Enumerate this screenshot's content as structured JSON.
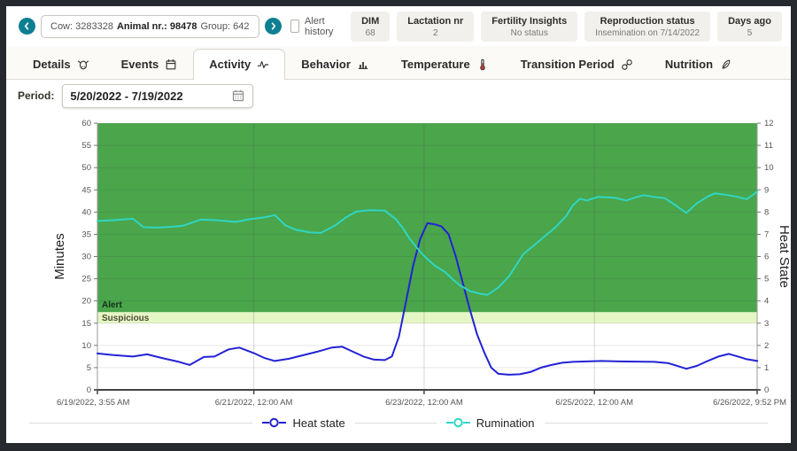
{
  "header": {
    "cow_selector": {
      "cow": "Cow: 3283328",
      "animal": "Animal nr.: 98478",
      "group": "Group: 642"
    },
    "alert_history_label": "Alert history",
    "info_boxes": [
      {
        "label": "DIM",
        "value": "68"
      },
      {
        "label": "Lactation nr",
        "value": "2"
      },
      {
        "label": "Fertility Insights",
        "value": "No status"
      },
      {
        "label": "Reproduction status",
        "value": "Insemination on 7/14/2022"
      },
      {
        "label": "Days ago",
        "value": "5"
      }
    ]
  },
  "tabs": [
    {
      "label": "Details",
      "icon": "cow-icon",
      "active": false
    },
    {
      "label": "Events",
      "icon": "calendar-icon",
      "active": false
    },
    {
      "label": "Activity",
      "icon": "activity-icon",
      "active": true
    },
    {
      "label": "Behavior",
      "icon": "bar-chart-icon",
      "active": false
    },
    {
      "label": "Temperature",
      "icon": "thermometer-icon",
      "active": false
    },
    {
      "label": "Transition Period",
      "icon": "link-icon",
      "active": false
    },
    {
      "label": "Nutrition",
      "icon": "feather-icon",
      "active": false
    }
  ],
  "period": {
    "label": "Period:",
    "value": "5/20/2022 - 7/19/2022"
  },
  "chart_data": {
    "type": "line",
    "left_axis": {
      "label": "Minutes",
      "min": 0,
      "max": 60,
      "step": 5
    },
    "right_axis": {
      "label": "Heat State",
      "min": 0,
      "max": 12,
      "step": 1
    },
    "x_axis": {
      "total_hours": 185.95,
      "ticks": [
        {
          "hours": 0,
          "label": "6/19/2022, 3:55 AM",
          "align": "start",
          "grid": false
        },
        {
          "hours": 44.08,
          "label": "6/21/2022, 12:00 AM",
          "align": "middle",
          "grid": true
        },
        {
          "hours": 92.08,
          "label": "6/23/2022, 12:00 AM",
          "align": "middle",
          "grid": true
        },
        {
          "hours": 140.08,
          "label": "6/25/2022, 12:00 AM",
          "align": "middle",
          "grid": true
        },
        {
          "hours": 185.95,
          "label": "6/26/2022, 9:52 PM",
          "align": "end",
          "grid": false
        }
      ]
    },
    "zones": [
      {
        "name": "Suspicious",
        "from_min": 15,
        "to_min": 17.5,
        "color": "#e4f6c4",
        "label_color": "#4c4c33"
      },
      {
        "name": "Alert",
        "from_min": 17.5,
        "to_min": 60,
        "color": "#4aa54b",
        "label_color": "#15301a"
      }
    ],
    "series": [
      {
        "name": "Heat state",
        "axis": "right",
        "color": "#2222d6",
        "points": [
          [
            0,
            1.64
          ],
          [
            5,
            1.56
          ],
          [
            10,
            1.5
          ],
          [
            14,
            1.6
          ],
          [
            18,
            1.44
          ],
          [
            23,
            1.26
          ],
          [
            26,
            1.12
          ],
          [
            30,
            1.48
          ],
          [
            33,
            1.5
          ],
          [
            37,
            1.82
          ],
          [
            40,
            1.9
          ],
          [
            44,
            1.66
          ],
          [
            47,
            1.44
          ],
          [
            50,
            1.3
          ],
          [
            54,
            1.4
          ],
          [
            58,
            1.56
          ],
          [
            62,
            1.72
          ],
          [
            66,
            1.9
          ],
          [
            69,
            1.94
          ],
          [
            72,
            1.72
          ],
          [
            75,
            1.5
          ],
          [
            78,
            1.36
          ],
          [
            81,
            1.34
          ],
          [
            83,
            1.5
          ],
          [
            85,
            2.4
          ],
          [
            87,
            4
          ],
          [
            89,
            5.6
          ],
          [
            91,
            6.8
          ],
          [
            93,
            7.5
          ],
          [
            95,
            7.45
          ],
          [
            97,
            7.35
          ],
          [
            99,
            7
          ],
          [
            101,
            6
          ],
          [
            103,
            4.8
          ],
          [
            105,
            3.6
          ],
          [
            107,
            2.5
          ],
          [
            109,
            1.7
          ],
          [
            111,
            1
          ],
          [
            113,
            0.72
          ],
          [
            116,
            0.68
          ],
          [
            119,
            0.7
          ],
          [
            122,
            0.8
          ],
          [
            125,
            1
          ],
          [
            128,
            1.12
          ],
          [
            131,
            1.22
          ],
          [
            134,
            1.26
          ],
          [
            138,
            1.28
          ],
          [
            142,
            1.3
          ],
          [
            147,
            1.28
          ],
          [
            152,
            1.27
          ],
          [
            157,
            1.26
          ],
          [
            161,
            1.2
          ],
          [
            164,
            1.05
          ],
          [
            166,
            0.95
          ],
          [
            169,
            1.08
          ],
          [
            172,
            1.3
          ],
          [
            175,
            1.5
          ],
          [
            178,
            1.62
          ],
          [
            181,
            1.48
          ],
          [
            183,
            1.38
          ],
          [
            186,
            1.3
          ]
        ]
      },
      {
        "name": "Rumination",
        "axis": "left",
        "color": "#2fd6c3",
        "points": [
          [
            0,
            38
          ],
          [
            5,
            38.2
          ],
          [
            10,
            38.5
          ],
          [
            13,
            36.6
          ],
          [
            17,
            36.5
          ],
          [
            21,
            36.7
          ],
          [
            24,
            36.9
          ],
          [
            29,
            38.3
          ],
          [
            33,
            38.2
          ],
          [
            36,
            38
          ],
          [
            39,
            37.8
          ],
          [
            43,
            38.4
          ],
          [
            47,
            38.8
          ],
          [
            50,
            39.3
          ],
          [
            53,
            37
          ],
          [
            56,
            36
          ],
          [
            60,
            35.4
          ],
          [
            63,
            35.3
          ],
          [
            67,
            37
          ],
          [
            70,
            38.8
          ],
          [
            73,
            40.1
          ],
          [
            77,
            40.4
          ],
          [
            81,
            40.3
          ],
          [
            84,
            38.5
          ],
          [
            86,
            36.5
          ],
          [
            88,
            34
          ],
          [
            90,
            32
          ],
          [
            92,
            30.2
          ],
          [
            95,
            28
          ],
          [
            98,
            26.5
          ],
          [
            100,
            25
          ],
          [
            102,
            23.6
          ],
          [
            105,
            22.2
          ],
          [
            108,
            21.6
          ],
          [
            110,
            21.4
          ],
          [
            113,
            23
          ],
          [
            116,
            25.5
          ],
          [
            118,
            28
          ],
          [
            120,
            30.5
          ],
          [
            123,
            32.5
          ],
          [
            126,
            34.5
          ],
          [
            129,
            36.5
          ],
          [
            132,
            39
          ],
          [
            134,
            41.5
          ],
          [
            136,
            43
          ],
          [
            138,
            42.6
          ],
          [
            141,
            43.4
          ],
          [
            144,
            43.3
          ],
          [
            146,
            43.2
          ],
          [
            149,
            42.6
          ],
          [
            152,
            43.4
          ],
          [
            154,
            43.8
          ],
          [
            157,
            43.4
          ],
          [
            160,
            43.1
          ],
          [
            163,
            41.5
          ],
          [
            166,
            39.8
          ],
          [
            169,
            42
          ],
          [
            172,
            43.5
          ],
          [
            174,
            44.2
          ],
          [
            177,
            43.9
          ],
          [
            180,
            43.5
          ],
          [
            183,
            42.9
          ],
          [
            186,
            44.6
          ]
        ]
      }
    ]
  },
  "legend": [
    {
      "label": "Heat state",
      "color": "#2222d6"
    },
    {
      "label": "Rumination",
      "color": "#2fd6c3"
    }
  ],
  "colors": {
    "accent_teal": "#0d7f93",
    "alert_zone": "#4aa54b",
    "suspicious_zone": "#e4f6c4",
    "frame": "#26292e"
  }
}
